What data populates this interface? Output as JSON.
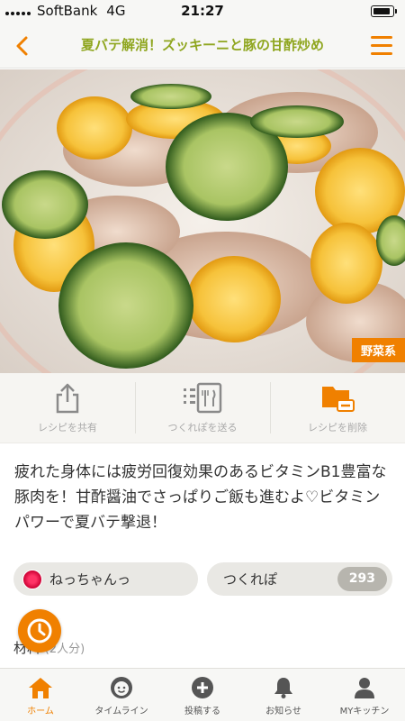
{
  "status_bar": {
    "carrier": "SoftBank",
    "network": "4G",
    "time": "21:27",
    "battery_level": 0.9
  },
  "header": {
    "title": "夏バテ解消！ズッキーニと豚の甘酢炒め",
    "back_icon": "chevron-left-icon",
    "menu_icon": "hamburger-menu-icon"
  },
  "photo": {
    "category_badge": "野菜系"
  },
  "actions": [
    {
      "label": "レシピを共有",
      "icon": "share-icon"
    },
    {
      "label": "つくれぽを送る",
      "icon": "send-report-icon"
    },
    {
      "label": "レシピを削除",
      "icon": "folder-remove-icon"
    }
  ],
  "description": "疲れた身体には疲労回復効果のあるビタミンB1豊富な豚肉を！甘酢醤油でさっぱりご飯も進むよ♡ビタミンパワーで夏バテ撃退！",
  "author": {
    "name": "ねっちゃんっ"
  },
  "tsukurepo": {
    "label": "つくれぽ",
    "count": "293"
  },
  "ingredients": {
    "heading": "材料",
    "servings": "(2人分)"
  },
  "tabbar": [
    {
      "label": "ホーム",
      "icon": "home-icon",
      "active": true
    },
    {
      "label": "タイムライン",
      "icon": "smiley-icon",
      "active": false
    },
    {
      "label": "投稿する",
      "icon": "plus-circle-icon",
      "active": false
    },
    {
      "label": "お知らせ",
      "icon": "bell-icon",
      "active": false
    },
    {
      "label": "MYキッチン",
      "icon": "user-icon",
      "active": false
    }
  ],
  "colors": {
    "accent": "#f08000",
    "title_green": "#8fa61f"
  }
}
